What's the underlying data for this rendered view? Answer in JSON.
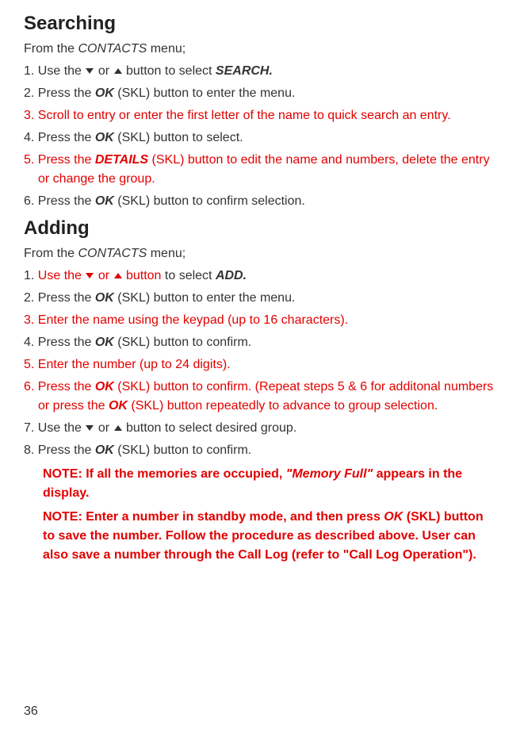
{
  "searching": {
    "heading": "Searching",
    "intro_pre": "From the ",
    "intro_menu": "CONTACTS",
    "intro_post": " menu;",
    "steps": [
      {
        "num": "1.",
        "parts": [
          {
            "text": "Use the ",
            "cls": ""
          },
          {
            "icon": "down"
          },
          {
            "text": " or ",
            "cls": ""
          },
          {
            "icon": "up"
          },
          {
            "text": "  button to select ",
            "cls": ""
          },
          {
            "text": "SEARCH.",
            "cls": "bolditalic"
          }
        ]
      },
      {
        "num": "2.",
        "parts": [
          {
            "text": "Press the ",
            "cls": ""
          },
          {
            "text": "OK",
            "cls": "bolditalic"
          },
          {
            "text": " (SKL) button to enter the menu.",
            "cls": ""
          }
        ]
      },
      {
        "num": "3.",
        "cls": "red",
        "parts": [
          {
            "text": "Scroll to entry or enter the ﬁrst letter of the name to quick search an entry.",
            "cls": ""
          }
        ]
      },
      {
        "num": "4.",
        "parts": [
          {
            "text": "Press the ",
            "cls": ""
          },
          {
            "text": "OK",
            "cls": "bolditalic"
          },
          {
            "text": " (SKL) button to select.",
            "cls": ""
          }
        ]
      },
      {
        "num": "5.",
        "cls": "red",
        "parts": [
          {
            "text": "Press the ",
            "cls": ""
          },
          {
            "text": "DETAILS",
            "cls": "bolditalic"
          },
          {
            "text": " (SKL) button to edit the name and numbers, delete the entry or change the group.",
            "cls": ""
          }
        ]
      },
      {
        "num": "6.",
        "parts": [
          {
            "text": "Press the ",
            "cls": ""
          },
          {
            "text": "OK",
            "cls": "bolditalic"
          },
          {
            "text": " (SKL) button to conﬁrm selection.",
            "cls": ""
          }
        ]
      }
    ]
  },
  "adding": {
    "heading": "Adding",
    "intro_pre": "From the ",
    "intro_menu": "CONTACTS",
    "intro_post": " menu;",
    "steps": [
      {
        "num": "1.",
        "parts": [
          {
            "text": "Use the ",
            "cls": "red"
          },
          {
            "icon": "down",
            "cls": "red"
          },
          {
            "text": " or ",
            "cls": "red"
          },
          {
            "icon": "up",
            "cls": "red"
          },
          {
            "text": "  button",
            "cls": "red"
          },
          {
            "text": " to select ",
            "cls": ""
          },
          {
            "text": "ADD.",
            "cls": "bolditalic"
          }
        ]
      },
      {
        "num": "2.",
        "parts": [
          {
            "text": "Press the ",
            "cls": ""
          },
          {
            "text": "OK",
            "cls": "bolditalic"
          },
          {
            "text": " (SKL) button to enter the menu.",
            "cls": ""
          }
        ]
      },
      {
        "num": "3.",
        "cls": "red",
        "parts": [
          {
            "text": "Enter the name using the keypad (up to 16 characters).",
            "cls": ""
          }
        ]
      },
      {
        "num": "4.",
        "parts": [
          {
            "text": "Press the ",
            "cls": ""
          },
          {
            "text": "OK",
            "cls": "bolditalic"
          },
          {
            "text": " (SKL) button to conﬁrm.",
            "cls": ""
          }
        ]
      },
      {
        "num": "5.",
        "cls": "red",
        "parts": [
          {
            "text": "Enter the number (up to 24 digits).",
            "cls": ""
          }
        ]
      },
      {
        "num": "6.",
        "cls": "red",
        "parts": [
          {
            "text": "Press the ",
            "cls": ""
          },
          {
            "text": "OK",
            "cls": "bolditalic"
          },
          {
            "text": " (SKL) button to conﬁrm. (Repeat steps 5 & 6 for additonal numbers or press the ",
            "cls": ""
          },
          {
            "text": "OK",
            "cls": "bolditalic"
          },
          {
            "text": " (SKL) button repeatedly to advance to group selection.",
            "cls": ""
          }
        ]
      },
      {
        "num": "7.",
        "parts": [
          {
            "text": "Use the ",
            "cls": ""
          },
          {
            "icon": "down"
          },
          {
            "text": " or ",
            "cls": ""
          },
          {
            "icon": "up"
          },
          {
            "text": "  button to select desired group.",
            "cls": ""
          }
        ]
      },
      {
        "num": "8.",
        "parts": [
          {
            "text": "Press the ",
            "cls": ""
          },
          {
            "text": "OK",
            "cls": "bolditalic"
          },
          {
            "text": " (SKL) button to conﬁrm.",
            "cls": ""
          }
        ]
      }
    ],
    "note1": {
      "pre": "NOTE: If all the memories are occupied, ",
      "mid": "\"Memory Full\"",
      "post": " appears in the display."
    },
    "note2": {
      "pre": "NOTE: Enter a number in standby mode, and then press ",
      "mid": "OK",
      "post": " (SKL) button to save the number. Follow the procedure as described above. User can also save a number through the Call Log (refer to \"Call Log Operation\")."
    }
  },
  "page_number": "36"
}
